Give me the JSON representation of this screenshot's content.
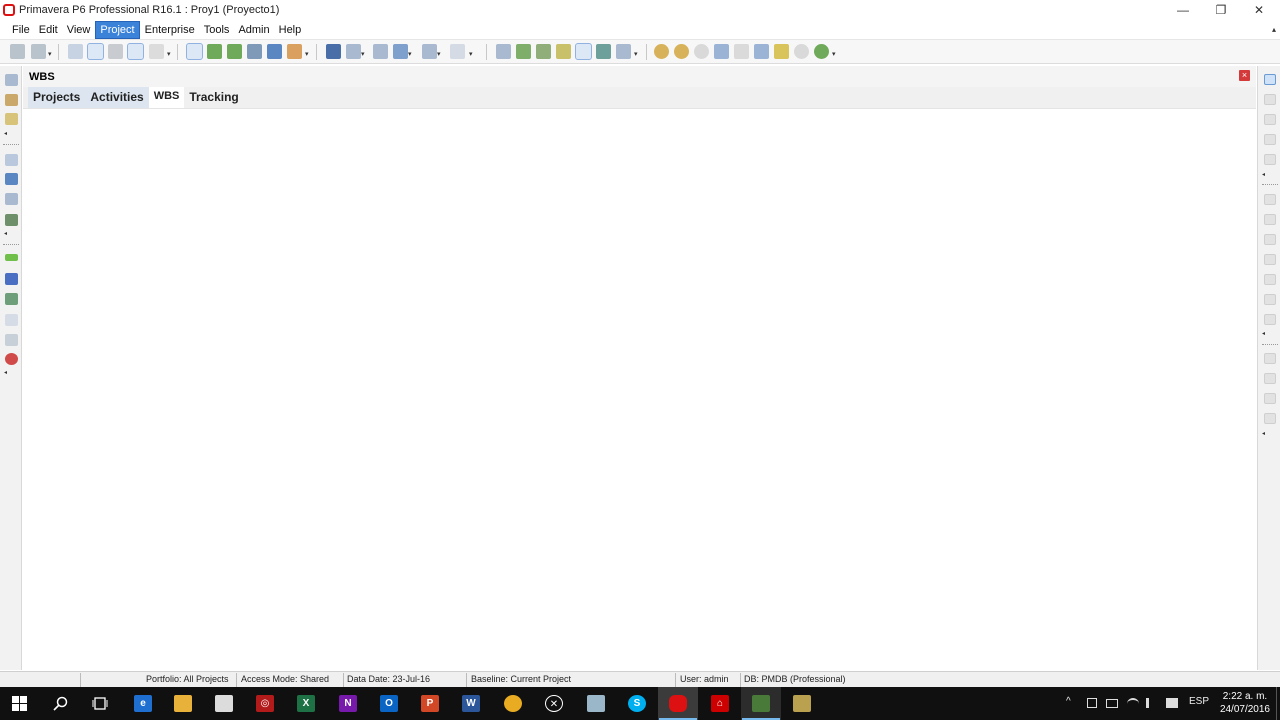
{
  "window": {
    "title": "Primavera P6 Professional R16.1 : Proy1 (Proyecto1)",
    "controls": {
      "minimize": "—",
      "restore": "❐",
      "close": "✕"
    }
  },
  "menubar": {
    "items": [
      "File",
      "Edit",
      "View",
      "Project",
      "Enterprise",
      "Tools",
      "Admin",
      "Help"
    ],
    "active": "Project",
    "overflow": "▴"
  },
  "toolbar": {
    "dropdown_glyph": "▾",
    "icons": [
      "print-icon",
      "print-preview-icon",
      "columns-icon",
      "indent-icon",
      "filter-link-icon",
      "trace-logic-icon",
      "assign-icon",
      "bars-icon",
      "details-icon",
      "timescale-icon",
      "chart-icon",
      "network-icon",
      "link-icon",
      "group-sort-icon",
      "layout-icon",
      "table-icon",
      "filter-icon",
      "columns-layout-icon",
      "number-icon",
      "reports-icon",
      "schedule-icon",
      "level-icon",
      "apply-actuals-icon",
      "progress-icon",
      "store-period-icon",
      "summarize-icon",
      "zoom-in-icon",
      "zoom-out-icon",
      "zoom-fit-icon",
      "expand-icon",
      "collapse-icon",
      "split-icon",
      "notebook-icon",
      "help-icon",
      "globe-icon"
    ]
  },
  "leftdock": {
    "icons": [
      "open-project-icon",
      "projects-icon",
      "edit-icon",
      "wbs-icon",
      "resources-icon",
      "activities-icon",
      "reports-icon",
      "tracking-icon",
      "issues-icon",
      "resource-assignments-icon",
      "work-products-icon",
      "expenses-icon",
      "risks-icon"
    ],
    "arrow": "◂"
  },
  "rightdock": {
    "icons": [
      "add-icon",
      "delete-icon",
      "cut-icon",
      "copy-icon",
      "paste-icon",
      "assign-icon",
      "assign-resource-icon",
      "remove-icon",
      "link-icon",
      "unlink-icon",
      "indent-icon",
      "outdent-icon",
      "move-up-icon",
      "move-down-icon",
      "move-left-icon",
      "move-right-icon"
    ],
    "arrow": "◂"
  },
  "panel": {
    "title": "WBS",
    "close": "×",
    "tabs": [
      {
        "label": "Projects",
        "state": "highlighted"
      },
      {
        "label": "Activities",
        "state": "highlighted"
      },
      {
        "label": "WBS",
        "state": "active"
      },
      {
        "label": "Tracking",
        "state": "normal"
      }
    ]
  },
  "statusbar": {
    "portfolio": "Portfolio: All Projects",
    "access_mode": "Access Mode: Shared",
    "data_date": "Data Date: 23-Jul-16",
    "baseline": "Baseline: Current Project",
    "user": "User: admin",
    "db": "DB: PMDB (Professional)"
  },
  "taskbar": {
    "apps": [
      {
        "name": "edge-icon",
        "glyph": "e",
        "color": "#1f6fd1"
      },
      {
        "name": "file-explorer-icon",
        "glyph": "",
        "color": "#e8b23a"
      },
      {
        "name": "store-icon",
        "glyph": "",
        "color": "#dcdcdc"
      },
      {
        "name": "acrobat-reader-icon",
        "glyph": "◎",
        "color": "#b31b1b"
      },
      {
        "name": "excel-icon",
        "glyph": "X",
        "color": "#1e7145"
      },
      {
        "name": "onenote-icon",
        "glyph": "N",
        "color": "#7719aa"
      },
      {
        "name": "outlook-icon",
        "glyph": "O",
        "color": "#0a64c4"
      },
      {
        "name": "powerpoint-icon",
        "glyph": "P",
        "color": "#d24726"
      },
      {
        "name": "word-icon",
        "glyph": "W",
        "color": "#2b579a"
      },
      {
        "name": "chrome-icon",
        "glyph": "",
        "color": "#e8ab22"
      },
      {
        "name": "xbox-icon",
        "glyph": "✕",
        "color": "#101010"
      },
      {
        "name": "notepad-icon",
        "glyph": "",
        "color": "#9ab7c9"
      },
      {
        "name": "skype-icon",
        "glyph": "S",
        "color": "#00aff0"
      },
      {
        "name": "primavera-icon",
        "glyph": "",
        "color": "#d11"
      },
      {
        "name": "acrobat-icon",
        "glyph": "⌂",
        "color": "#cc0000"
      },
      {
        "name": "primavera-app-icon",
        "glyph": "",
        "color": "#4a7a3a"
      },
      {
        "name": "misc-app-icon",
        "glyph": "",
        "color": "#b9a14f"
      }
    ],
    "tray_lang": "ESP",
    "clock_time": "2:22 a. m.",
    "clock_date": "24/07/2016"
  },
  "colors": {
    "menu_active": "#3b82d9",
    "tab_highlight": "#dde6f0",
    "close_red": "#d43a3a",
    "taskbar": "#101010"
  }
}
